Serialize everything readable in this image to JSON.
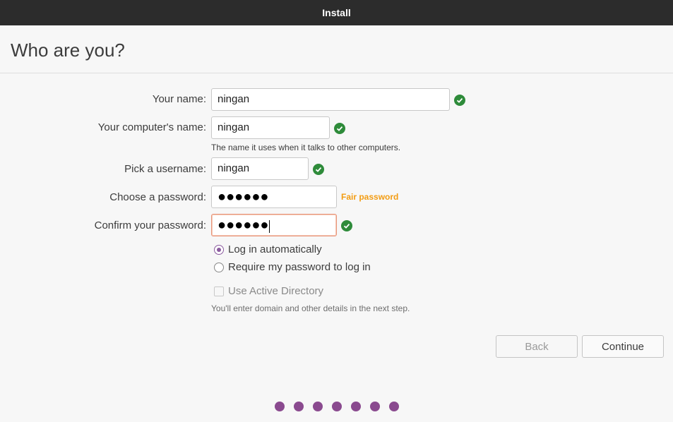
{
  "window": {
    "title": "Install"
  },
  "page": {
    "title": "Who are you?"
  },
  "form": {
    "name": {
      "label": "Your name:",
      "value": "ningan"
    },
    "computer": {
      "label": "Your computer's name:",
      "value": "ningan",
      "hint": "The name it uses when it talks to other computers."
    },
    "username": {
      "label": "Pick a username:",
      "value": "ningan"
    },
    "password": {
      "label": "Choose a password:",
      "value": "●●●●●●",
      "strength": "Fair password"
    },
    "confirm": {
      "label": "Confirm your password:",
      "value": "●●●●●●"
    }
  },
  "login": {
    "auto_label": "Log in automatically",
    "require_label": "Require my password to log in",
    "selected": "auto"
  },
  "active_directory": {
    "label": "Use Active Directory",
    "note": "You'll enter domain and other details in the next step.",
    "checked": false,
    "enabled": false
  },
  "buttons": {
    "back": "Back",
    "continue": "Continue"
  },
  "progress": {
    "total_steps": 7
  },
  "colors": {
    "accent": "#8a4a8f",
    "valid": "#2e8b3a",
    "strength": "#f39c12"
  },
  "icons": {
    "valid": "check-circle-icon"
  }
}
